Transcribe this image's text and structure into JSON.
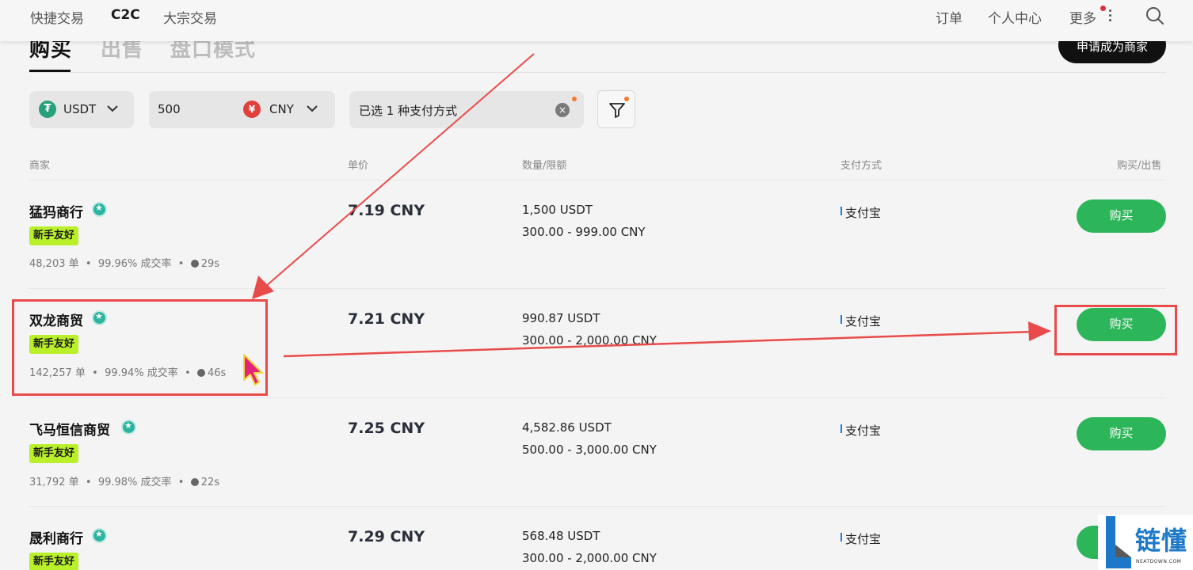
{
  "nav": {
    "left": [
      "快捷交易",
      "C2C",
      "大宗交易"
    ],
    "right": [
      "订单",
      "个人中心",
      "更多"
    ]
  },
  "tabs": [
    "购买",
    "出售",
    "盘口模式"
  ],
  "merchant_apply": "申请成为商家",
  "filters": {
    "coin": "USDT",
    "amount": "500",
    "currency": "CNY",
    "currency_symbol": "¥",
    "coin_symbol": "₮",
    "payment": "已选 1 种支付方式"
  },
  "columns": {
    "merchant": "商家",
    "price": "单价",
    "qty": "数量/限额",
    "payment": "支付方式",
    "action": "购买/出售"
  },
  "rows": [
    {
      "name": "猛犸商行",
      "tag": "新手友好",
      "orders": "48,203 单",
      "rate": "99.96% 成交率",
      "time": "29s",
      "price": "7.19 CNY",
      "qty": "1,500 USDT",
      "limit": "300.00 - 999.00 CNY",
      "pay": "支付宝",
      "btn": "购买"
    },
    {
      "name": "双龙商贸",
      "tag": "新手友好",
      "orders": "142,257 单",
      "rate": "99.94% 成交率",
      "time": "46s",
      "price": "7.21 CNY",
      "qty": "990.87 USDT",
      "limit": "300.00 - 2,000.00 CNY",
      "pay": "支付宝",
      "btn": "购买"
    },
    {
      "name": "飞马恒信商贸",
      "tag": "新手友好",
      "orders": "31,792 单",
      "rate": "99.98% 成交率",
      "time": "22s",
      "price": "7.25 CNY",
      "qty": "4,582.86 USDT",
      "limit": "500.00 - 3,000.00 CNY",
      "pay": "支付宝",
      "btn": "购买"
    },
    {
      "name": "晟利商行",
      "tag": "新手友好",
      "orders": "",
      "rate": "",
      "time": "",
      "price": "7.29 CNY",
      "qty": "568.48 USDT",
      "limit": "300.00 - 2,000.00 CNY",
      "pay": "支付宝",
      "btn": ""
    }
  ],
  "watermark": {
    "main": "链懂",
    "sub": "NEATDOWN.COM"
  },
  "colors": {
    "buy": "#2db55a",
    "tag": "#b9f02a",
    "annotation": "#e94b4b",
    "verified": "#2bb5a0"
  }
}
